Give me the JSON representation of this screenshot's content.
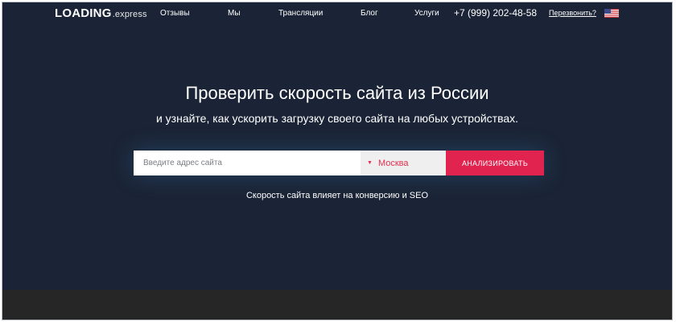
{
  "header": {
    "logo_main": "LOADING",
    "logo_suffix": ".express",
    "nav": [
      "Отзывы",
      "Мы",
      "Трансляции",
      "Блог",
      "Услуги"
    ],
    "phone": "+7 (999) 202-48-58",
    "callback_label": "Перезвонить?",
    "language_icon": "us-flag-icon"
  },
  "hero": {
    "title": "Проверить скорость сайта из России",
    "subtitle": "и узнайте, как ускорить загрузку своего сайта на любых устройствах."
  },
  "form": {
    "url_placeholder": "Введите адрес сайта",
    "city_value": "Москва",
    "analyze_label": "АНАЛИЗИРОВАТЬ"
  },
  "note": "Скорость сайта влияет на конверсию и SEO",
  "colors": {
    "background": "#1b2436",
    "accent": "#e0234f",
    "bottom_band": "#262626"
  }
}
